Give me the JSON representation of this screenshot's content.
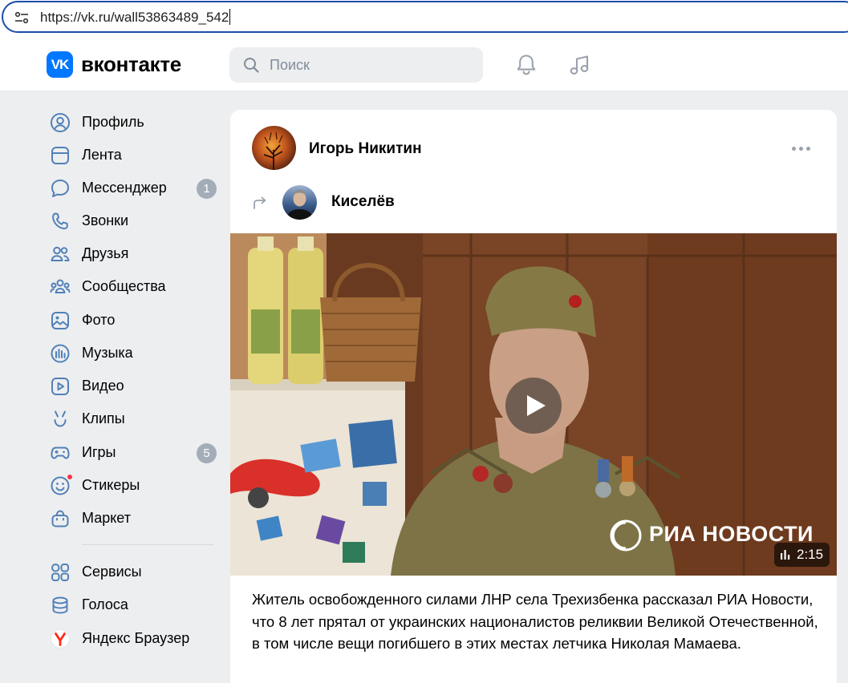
{
  "browser": {
    "url": "https://vk.ru/wall53863489_542"
  },
  "header": {
    "brand": "вконтакте",
    "logo_letters": "VK",
    "search_placeholder": "Поиск",
    "accent": "#0077ff",
    "icons": [
      "bell-icon",
      "music-note-icon"
    ]
  },
  "sidebar": {
    "items": [
      {
        "label": "Профиль",
        "icon": "profile-icon"
      },
      {
        "label": "Лента",
        "icon": "feed-icon"
      },
      {
        "label": "Мессенджер",
        "icon": "messenger-icon",
        "badge": "1"
      },
      {
        "label": "Звонки",
        "icon": "phone-icon"
      },
      {
        "label": "Друзья",
        "icon": "friends-icon"
      },
      {
        "label": "Сообщества",
        "icon": "communities-icon"
      },
      {
        "label": "Фото",
        "icon": "photo-icon"
      },
      {
        "label": "Музыка",
        "icon": "music-icon"
      },
      {
        "label": "Видео",
        "icon": "video-icon"
      },
      {
        "label": "Клипы",
        "icon": "clips-icon"
      },
      {
        "label": "Игры",
        "icon": "games-icon",
        "badge": "5"
      },
      {
        "label": "Стикеры",
        "icon": "stickers-icon"
      },
      {
        "label": "Маркет",
        "icon": "market-icon"
      },
      {
        "label": "Сервисы",
        "icon": "services-icon"
      },
      {
        "label": "Голоса",
        "icon": "votes-icon"
      },
      {
        "label": "Яндекс Браузер",
        "icon": "yandex-browser-icon"
      }
    ]
  },
  "post": {
    "author": "Игорь Никитин",
    "repost_author": "Киселёв",
    "video": {
      "watermark": "РИА НОВОСТИ",
      "duration": "2:15"
    },
    "text": "Житель освобожденного силами ЛНР села Трехизбенка рассказал РИА Новости, что 8 лет прятал от украинских националистов реликвии Великой Отечественной, в том числе вещи погибшего в этих местах летчика Николая Мамаева."
  }
}
